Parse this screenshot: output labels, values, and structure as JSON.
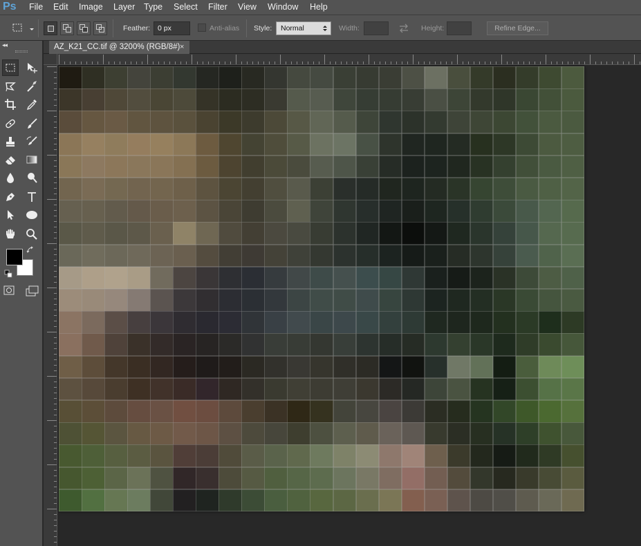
{
  "app": {
    "logo": "Ps"
  },
  "menu": [
    "File",
    "Edit",
    "Image",
    "Layer",
    "Type",
    "Select",
    "Filter",
    "View",
    "Window",
    "Help"
  ],
  "options": {
    "feather_label": "Feather:",
    "feather_value": "0 px",
    "antialias_label": "Anti-alias",
    "style_label": "Style:",
    "style_value": "Normal",
    "width_label": "Width:",
    "height_label": "Height:",
    "refine_label": "Refine Edge..."
  },
  "document": {
    "tab_title": "AZ_K21_CC.tif @ 3200% (RGB/8#)",
    "close_glyph": "×"
  },
  "colors": {
    "foreground": "#000000",
    "background": "#ffffff",
    "accent": "#5fa4d8"
  },
  "tools": [
    "rectangular-marquee",
    "move",
    "lasso",
    "magic-wand",
    "crop",
    "eyedropper",
    "spot-healing",
    "brush",
    "clone-stamp",
    "history-brush",
    "eraser",
    "gradient",
    "blur",
    "dodge",
    "pen",
    "type",
    "path-selection",
    "ellipse",
    "hand",
    "zoom"
  ],
  "canvas_pixels": [
    [
      "#1f1b12",
      "#2f2f23",
      "#3d3f32",
      "#44443c",
      "#3c3e33",
      "#333830",
      "#252722",
      "#1e201b",
      "#282922",
      "#343630",
      "#45493f",
      "#454a41",
      "#3a3f35",
      "#373b32",
      "#3a3d34",
      "#4d5045",
      "#6c7062",
      "#494e3d",
      "#343a29",
      "#2b2e20",
      "#343c2a",
      "#3e4a31",
      "#4c5a3e"
    ],
    [
      "#3c3629",
      "#483f33",
      "#4f4838",
      "#524d3e",
      "#4a4635",
      "#4d4a3a",
      "#353327",
      "#2c2c21",
      "#2d2d23",
      "#3a3a31",
      "#555a4c",
      "#575c50",
      "#3f463b",
      "#363d34",
      "#363c33",
      "#383d34",
      "#4a4f44",
      "#3d4537",
      "#33392c",
      "#2f3629",
      "#3a4733",
      "#425038",
      "#4b5a3e"
    ],
    [
      "#5a4c3b",
      "#665741",
      "#6a5a45",
      "#615540",
      "#5e533f",
      "#5a513d",
      "#4a4331",
      "#3c3928",
      "#3d3b2d",
      "#4c4938",
      "#575846",
      "#616656",
      "#555b4c",
      "#3e4539",
      "#2f362f",
      "#2c322a",
      "#333a30",
      "#3e4438",
      "#3e4636",
      "#3c4733",
      "#42513a",
      "#4b5a40",
      "#4b5a40"
    ],
    [
      "#8b7657",
      "#968060",
      "#8f7c5c",
      "#957d5e",
      "#96805e",
      "#8c7858",
      "#6d5b40",
      "#4f4630",
      "#444333",
      "#4f4d3b",
      "#575a47",
      "#6c7261",
      "#6c7464",
      "#485145",
      "#2e342c",
      "#202621",
      "#1f2620",
      "#242b23",
      "#27301f",
      "#2d3726",
      "#3d4a35",
      "#4c5a40",
      "#4e5d42"
    ],
    [
      "#8a7758",
      "#8d7960",
      "#8c775a",
      "#8a775b",
      "#8a7659",
      "#847052",
      "#6c5b40",
      "#4d4430",
      "#413e2f",
      "#4b4a39",
      "#4a4b3d",
      "#575c4f",
      "#4e5549",
      "#394036",
      "#262c26",
      "#1c221e",
      "#1d241f",
      "#20271f",
      "#283223",
      "#34402f",
      "#414f39",
      "#4a5a41",
      "#4f5f44"
    ],
    [
      "#72654f",
      "#7a6b55",
      "#746851",
      "#72644f",
      "#73654e",
      "#6e604a",
      "#5d5340",
      "#4b4533",
      "#433f31",
      "#504e3f",
      "#595a4c",
      "#3c4035",
      "#2a2f2b",
      "#252b27",
      "#20261f",
      "#1e251f",
      "#242b23",
      "#2a3427",
      "#364531",
      "#3e4d39",
      "#4a5a42",
      "#4f6045",
      "#536448"
    ],
    [
      "#666050",
      "#67604f",
      "#625b4c",
      "#64594a",
      "#6a5d4b",
      "#6d604d",
      "#5c5343",
      "#4a4537",
      "#3e3c31",
      "#4b4b3e",
      "#5f6050",
      "#3f443a",
      "#2f3630",
      "#272e2b",
      "#1f2522",
      "#1a1f1b",
      "#1e2620",
      "#26302a",
      "#2f3c30",
      "#3b4a3a",
      "#48594a",
      "#536650",
      "#566a4d"
    ],
    [
      "#5a5848",
      "#5f5b4b",
      "#5a5748",
      "#5d5849",
      "#6a604e",
      "#8f8367",
      "#6f6753",
      "#504b3e",
      "#433f34",
      "#4b493f",
      "#494a40",
      "#383c33",
      "#2c322d",
      "#202623",
      "#131714",
      "#0c0e0c",
      "#141815",
      "#1f2820",
      "#2a352c",
      "#35423a",
      "#46574a",
      "#55684f",
      "#576b4f"
    ],
    [
      "#6a6859",
      "#706c5c",
      "#6c6859",
      "#6f695a",
      "#6c6354",
      "#6a5f4f",
      "#544c3f",
      "#423e35",
      "#3e3a34",
      "#444238",
      "#3f4139",
      "#343831",
      "#2c322e",
      "#262e2a",
      "#1c2320",
      "#161b18",
      "#1a201c",
      "#262c25",
      "#2d352d",
      "#36423a",
      "#4a5b4e",
      "#50634b",
      "#5a6e53"
    ],
    [
      "#a69a87",
      "#ae9f89",
      "#b0a28c",
      "#a99c86",
      "#716b5d",
      "#4c4541",
      "#3a3637",
      "#2e2f33",
      "#2b2e34",
      "#363b3e",
      "#414848",
      "#3e4b49",
      "#45504e",
      "#3c4d4d",
      "#364744",
      "#2f3835",
      "#1a201d",
      "#161b17",
      "#1c231c",
      "#2a3226",
      "#3d4a38",
      "#4d5c44",
      "#4f6149"
    ],
    [
      "#9c8c7a",
      "#998a79",
      "#96887c",
      "#857a73",
      "#5b5450",
      "#3c383a",
      "#312e31",
      "#2c2d33",
      "#2b2f34",
      "#33383c",
      "#3c4544",
      "#404c48",
      "#404c47",
      "#3f4b4b",
      "#37453f",
      "#2e3834",
      "#1c2420",
      "#1f2820",
      "#232e23",
      "#2a3726",
      "#3a4a35",
      "#45553e",
      "#4a5a41"
    ],
    [
      "#8b7463",
      "#7b6a5d",
      "#5b4e47",
      "#473f3f",
      "#3b363a",
      "#2f2c31",
      "#2a2930",
      "#2c2c34",
      "#303438",
      "#394045",
      "#414a4d",
      "#3a4647",
      "#3d484b",
      "#394848",
      "#33403d",
      "#2e3a35",
      "#1f2820",
      "#1e261e",
      "#1e281d",
      "#23301f",
      "#2b3a26",
      "#1e2e1c",
      "#2d3a25"
    ],
    [
      "#8a705f",
      "#705a4b",
      "#4f423a",
      "#3a3129",
      "#332b29",
      "#2a2424",
      "#272423",
      "#2b2a28",
      "#313232",
      "#393d38",
      "#383c36",
      "#343731",
      "#383e39",
      "#2d3430",
      "#262d28",
      "#262c25",
      "#2d392f",
      "#344030",
      "#2a3728",
      "#1e2a1d",
      "#2f3c28",
      "#3a4a2f",
      "#46573a"
    ],
    [
      "#6f5e47",
      "#5d4d3a",
      "#44372a",
      "#3a2e23",
      "#322722",
      "#251d1b",
      "#1f1b1a",
      "#221d1a",
      "#2b2923",
      "#32312c",
      "#393833",
      "#36352d",
      "#302f29",
      "#2c2b25",
      "#141616",
      "#111310",
      "#27302b",
      "#707866",
      "#627158",
      "#141d13",
      "#4a5d3c",
      "#6e8a59",
      "#6e8e59"
    ],
    [
      "#5d5140",
      "#57493a",
      "#4a3d2f",
      "#3e3024",
      "#41322a",
      "#3a2b27",
      "#32262b",
      "#2f2823",
      "#33302a",
      "#3a3a30",
      "#403f35",
      "#3d3c33",
      "#3f3e36",
      "#3b382f",
      "#2c2a26",
      "#252824",
      "#3d4539",
      "#4a5341",
      "#263321",
      "#162016",
      "#3c4f31",
      "#567247",
      "#5a7648"
    ],
    [
      "#584f36",
      "#5c4e38",
      "#5d4b3c",
      "#664d40",
      "#6a5144",
      "#714f41",
      "#6c4d40",
      "#5d4a3c",
      "#4a3e2f",
      "#3b3225",
      "#2f2816",
      "#35321f",
      "#43443a",
      "#47463f",
      "#4a4441",
      "#3c3a36",
      "#2b2d23",
      "#262c1e",
      "#253420",
      "#324728",
      "#3e5829",
      "#4b6930",
      "#56713c"
    ],
    [
      "#4e5135",
      "#555535",
      "#5b5540",
      "#675943",
      "#6d5a46",
      "#725a4a",
      "#6d5647",
      "#5d5043",
      "#4d4a3c",
      "#47463b",
      "#3e3e2f",
      "#4d5040",
      "#5d5f4e",
      "#5f5b4c",
      "#6a625a",
      "#5e5852",
      "#383a2e",
      "#2b2e24",
      "#272f21",
      "#263226",
      "#2e3f28",
      "#3f522f",
      "#48583b"
    ],
    [
      "#485930",
      "#4e5f38",
      "#575f40",
      "#5b5c42",
      "#5a543f",
      "#503e38",
      "#4b3d37",
      "#504b3a",
      "#5a5c48",
      "#5a634b",
      "#60694d",
      "#6e7a5e",
      "#7e8268",
      "#8c8b74",
      "#8e786c",
      "#a08478",
      "#6e5f4d",
      "#3b3a2b",
      "#23281d",
      "#161b15",
      "#212a1c",
      "#2f3a25",
      "#46502f"
    ],
    [
      "#46572f",
      "#4d6035",
      "#5b6547",
      "#6b7258",
      "#4f5241",
      "#312728",
      "#392f2e",
      "#4d4b3a",
      "#565a43",
      "#505f3f",
      "#566647",
      "#5d6c4e",
      "#6c755e",
      "#797865",
      "#7f6d61",
      "#936e66",
      "#735e52",
      "#534b3c",
      "#33372b",
      "#27291f",
      "#393a2b",
      "#484b35",
      "#5a5b3f"
    ],
    [
      "#3e5a2e",
      "#527041",
      "#667753",
      "#6c7c5f",
      "#414739",
      "#222021",
      "#1f2420",
      "#2f3a2b",
      "#3c4c36",
      "#4a5e3f",
      "#50623f",
      "#58673f",
      "#5c6744",
      "#6a6e4e",
      "#7b7656",
      "#835f4f",
      "#7a6054",
      "#5e534c",
      "#4d4a44",
      "#504e48",
      "#5e5b4f",
      "#6a6958",
      "#6f6a51"
    ]
  ]
}
